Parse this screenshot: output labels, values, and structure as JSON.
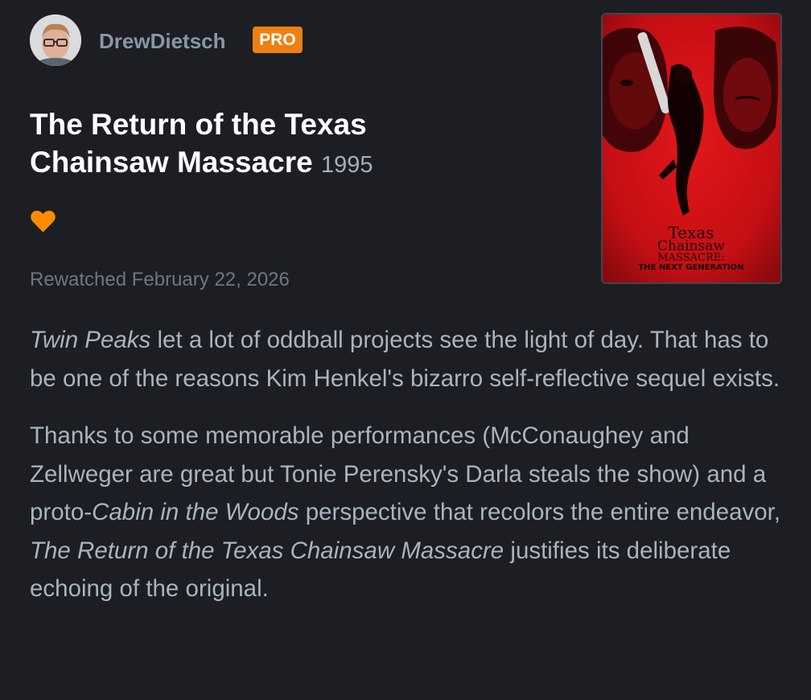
{
  "user": {
    "name": "DrewDietsch",
    "badge": "PRO",
    "avatar": "avatar"
  },
  "film": {
    "title": "The Return of the Texas Chainsaw Massacre",
    "year": "1995",
    "liked": true,
    "watched_text": "Rewatched February 22, 2026"
  },
  "poster": {
    "line1": "Texas",
    "line2": "Chainsaw",
    "line3": "MASSACRE:",
    "line4": "THE NEXT GENERATION"
  },
  "review": {
    "p1_a": "Twin Peaks",
    "p1_b": " let a lot of oddball projects see the light of day. That has to be one of the reasons Kim Henkel's bizarro self-reflective sequel exists.",
    "p2_a": "Thanks to some memorable performances (McConaughey and Zellweger are great but Tonie Perensky's Darla steals the show) and a proto-",
    "p2_b": "Cabin in the Woods",
    "p2_c": " perspective that recolors the entire endeavor, ",
    "p2_d": "The Return of the Texas Chainsaw Massacre",
    "p2_e": " justifies its deliberate echoing of the original."
  },
  "colors": {
    "accent": "#ee7f10",
    "background": "#1c1e23",
    "heart": "#ff8c00"
  },
  "icons": {
    "like": "heart-icon"
  }
}
